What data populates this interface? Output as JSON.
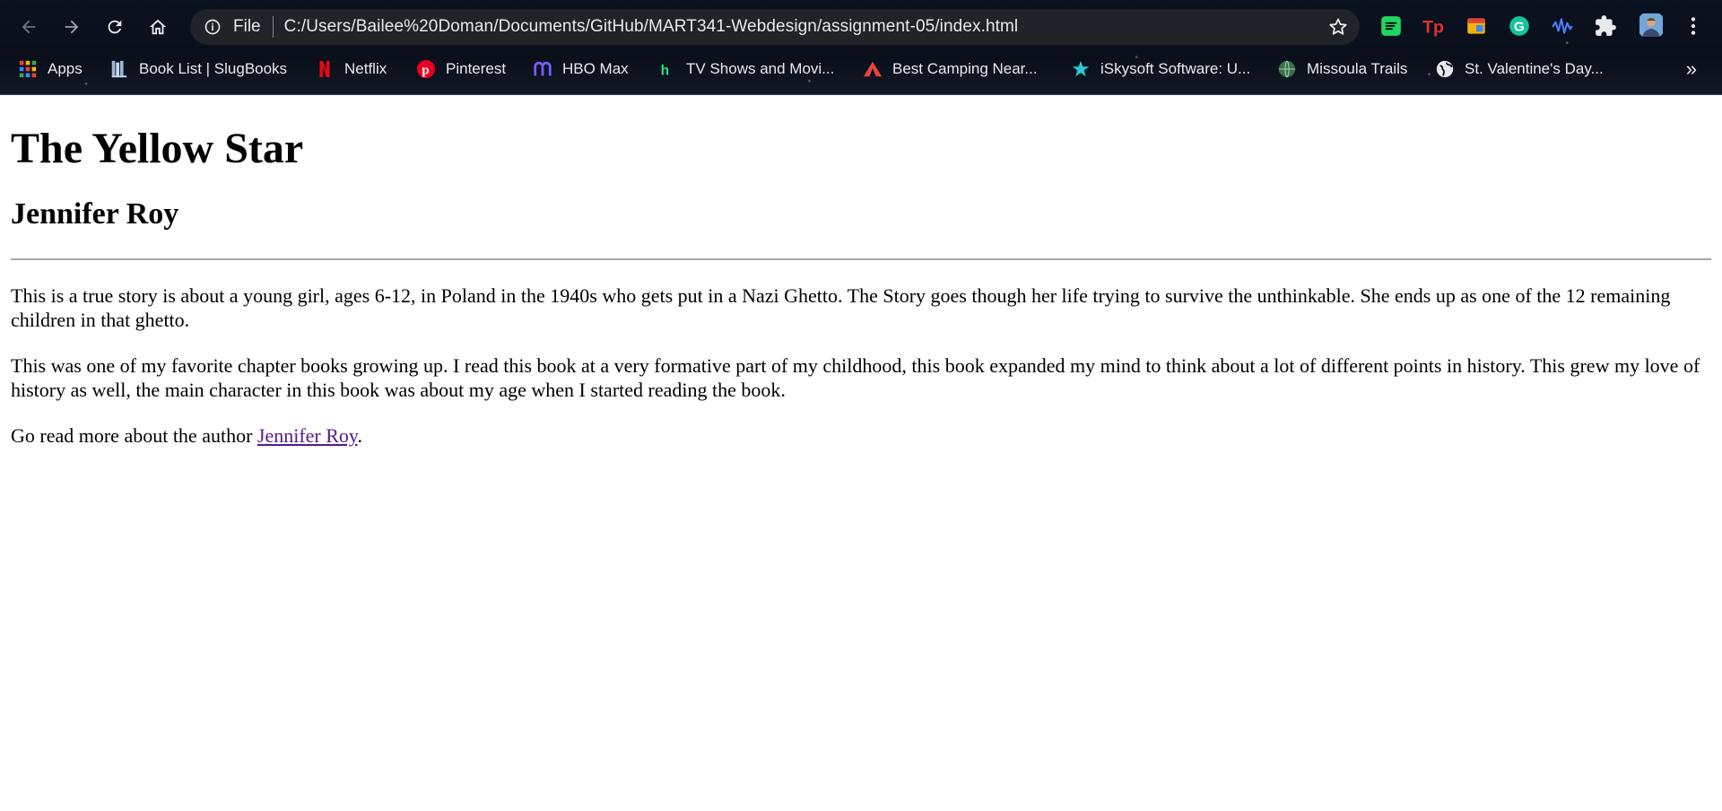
{
  "browser": {
    "address_bar": {
      "scheme_label": "File",
      "url": "C:/Users/Bailee%20Doman/Documents/GitHub/MART341-Webdesign/assignment-05/index.html"
    },
    "nav_icons": [
      "back-icon",
      "forward-icon",
      "reload-icon",
      "home-icon"
    ],
    "extension_icons": [
      "spotify-extension-icon",
      "tp-extension-icon",
      "calendar-extension-icon",
      "grammarly-extension-icon",
      "soundwave-extension-icon",
      "puzzle-icon",
      "profile-avatar",
      "menu-dots-icon"
    ],
    "bookmarks": [
      {
        "label": "Apps",
        "icon": "apps-grid-icon"
      },
      {
        "label": "Book List | SlugBooks",
        "icon": "book-icon"
      },
      {
        "label": "Netflix",
        "icon": "netflix-icon"
      },
      {
        "label": "Pinterest",
        "icon": "pinterest-icon"
      },
      {
        "label": "HBO Max",
        "icon": "hbo-max-icon"
      },
      {
        "label": "TV Shows and Movi...",
        "icon": "hulu-icon"
      },
      {
        "label": "Best Camping Near...",
        "icon": "tent-icon"
      },
      {
        "label": "iSkysoft Software: U...",
        "icon": "star-icon"
      },
      {
        "label": "Missoula Trails",
        "icon": "globe-icon"
      },
      {
        "label": "St. Valentine's Day...",
        "icon": "world-icon"
      }
    ],
    "more_bookmarks_label": "»",
    "colors": {
      "chrome_bg": "#0b1220",
      "omnibox_bg": "#202327",
      "chrome_text": "#e8eaed"
    }
  },
  "page": {
    "title": "The Yellow Star",
    "author_heading": "Jennifer Roy",
    "paragraphs": [
      "This is a true story is about a young girl, ages 6-12, in Poland in the 1940s who gets put in a Nazi Ghetto. The Story goes though her life trying to survive the unthinkable. She ends up as one of the 12 remaining children in that ghetto.",
      "This was one of my favorite chapter books growing up. I read this book at a very formative part of my childhood, this book expanded my mind to think about a lot of different points in history. This grew my love of history as well, the main character in this book was about my age when I started reading the book."
    ],
    "link_sentence": {
      "prefix": "Go read more about the author ",
      "link_text": "Jennifer Roy",
      "suffix": "."
    },
    "colors": {
      "visited_link": "#551a8b",
      "divider": "#a8a8a8"
    }
  }
}
